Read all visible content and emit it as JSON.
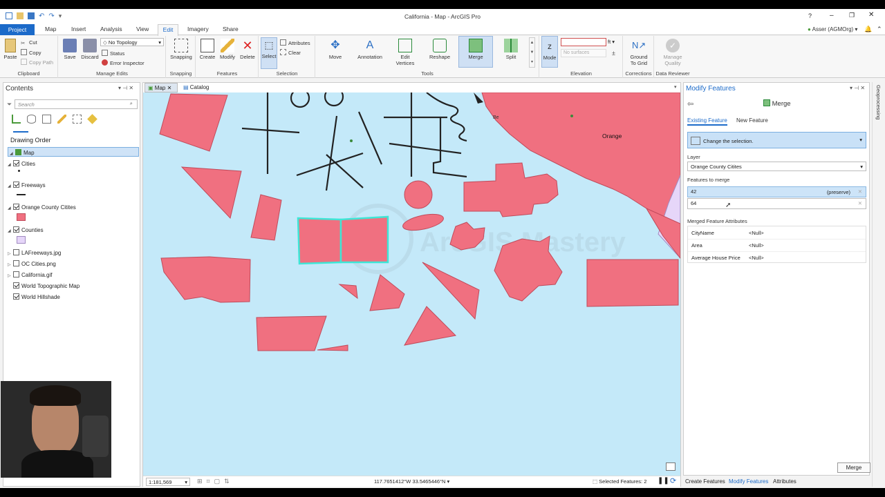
{
  "window": {
    "title": "California - Map - ArcGIS Pro",
    "help": "?",
    "user": "Asser (AGMOrg)"
  },
  "quick_access": [
    "new",
    "open",
    "save",
    "undo",
    "redo",
    "customize"
  ],
  "ribbon_tabs": [
    {
      "label": "Project"
    },
    {
      "label": "Map"
    },
    {
      "label": "Insert"
    },
    {
      "label": "Analysis"
    },
    {
      "label": "View"
    },
    {
      "label": "Edit"
    },
    {
      "label": "Imagery"
    },
    {
      "label": "Share"
    }
  ],
  "active_tab": "Edit",
  "clipboard": {
    "paste": "Paste",
    "cut": "Cut",
    "copy": "Copy",
    "copy_path": "Copy Path",
    "label": "Clipboard"
  },
  "manage_edits": {
    "save": "Save",
    "discard": "Discard",
    "topology": "No Topology",
    "status": "Status",
    "error_inspector": "Error Inspector",
    "label": "Manage Edits"
  },
  "snapping": {
    "button": "Snapping",
    "label": "Snapping"
  },
  "features": {
    "create": "Create",
    "modify": "Modify",
    "delete": "Delete",
    "label": "Features"
  },
  "selection": {
    "select": "Select",
    "attributes": "Attributes",
    "clear": "Clear",
    "label": "Selection"
  },
  "tools": {
    "items": [
      "Move",
      "Annotation",
      "Edit Vertices",
      "Reshape",
      "Merge",
      "Split"
    ],
    "label": "Tools"
  },
  "elevation": {
    "mode": "Mode",
    "unit": "ft",
    "no_surfaces": "No surfaces",
    "label": "Elevation"
  },
  "corrections": {
    "ground": "Ground To Grid",
    "label": "Corrections"
  },
  "data_reviewer": {
    "manage": "Manage Quality",
    "label": "Data Reviewer"
  },
  "contents": {
    "title": "Contents",
    "search_placeholder": "Search",
    "drawing_order": "Drawing Order",
    "map_label": "Map",
    "layers": [
      {
        "name": "Cities",
        "checked": true,
        "expanded": true
      },
      {
        "name": "Freeways",
        "checked": true,
        "expanded": true
      },
      {
        "name": "Orange County Citites",
        "checked": true,
        "expanded": true
      },
      {
        "name": "Counties",
        "checked": true,
        "expanded": true
      },
      {
        "name": "LAFreeways.jpg",
        "checked": false,
        "expanded": false
      },
      {
        "name": "OC Cities.png",
        "checked": false,
        "expanded": false
      },
      {
        "name": "California.gif",
        "checked": false,
        "expanded": false
      },
      {
        "name": "World Topographic Map",
        "checked": true,
        "expanded": false
      },
      {
        "name": "World Hillshade",
        "checked": true,
        "expanded": false
      }
    ],
    "colors": {
      "polygon": "#f07080",
      "county": "#e6d6f9",
      "water": "#c4e9f9",
      "selected": "#3ee6d6"
    }
  },
  "map_tabs": [
    {
      "label": "Map"
    },
    {
      "label": "Catalog"
    }
  ],
  "map": {
    "label_orange": "Orange",
    "label_be": "Be",
    "scale": "1:181,569",
    "coords": "117.7651412°W 33.5465446°N",
    "selected_features": "Selected Features: 2",
    "watermark": "ArcGIS Mastery"
  },
  "modify_panel": {
    "title": "Modify Features",
    "tool": "Merge",
    "tab_existing": "Existing Feature",
    "tab_new": "New Feature",
    "banner": "Change the selection.",
    "layer_label": "Layer",
    "layer_value": "Orange County Citites",
    "features_label": "Features to merge",
    "features": [
      {
        "id": "42",
        "note": "(preserve)"
      },
      {
        "id": "64",
        "note": ""
      }
    ],
    "attrs_label": "Merged Feature Attributes",
    "attrs": [
      {
        "name": "CityName",
        "value": "<Null>"
      },
      {
        "name": "Area",
        "value": "<Null>"
      },
      {
        "name": "Average House Price",
        "value": "<Null>"
      }
    ],
    "merge_button": "Merge"
  },
  "bottom_tabs": [
    "Create Features",
    "Modify Features",
    "Attributes"
  ],
  "right_strip": "Geoprocessing"
}
